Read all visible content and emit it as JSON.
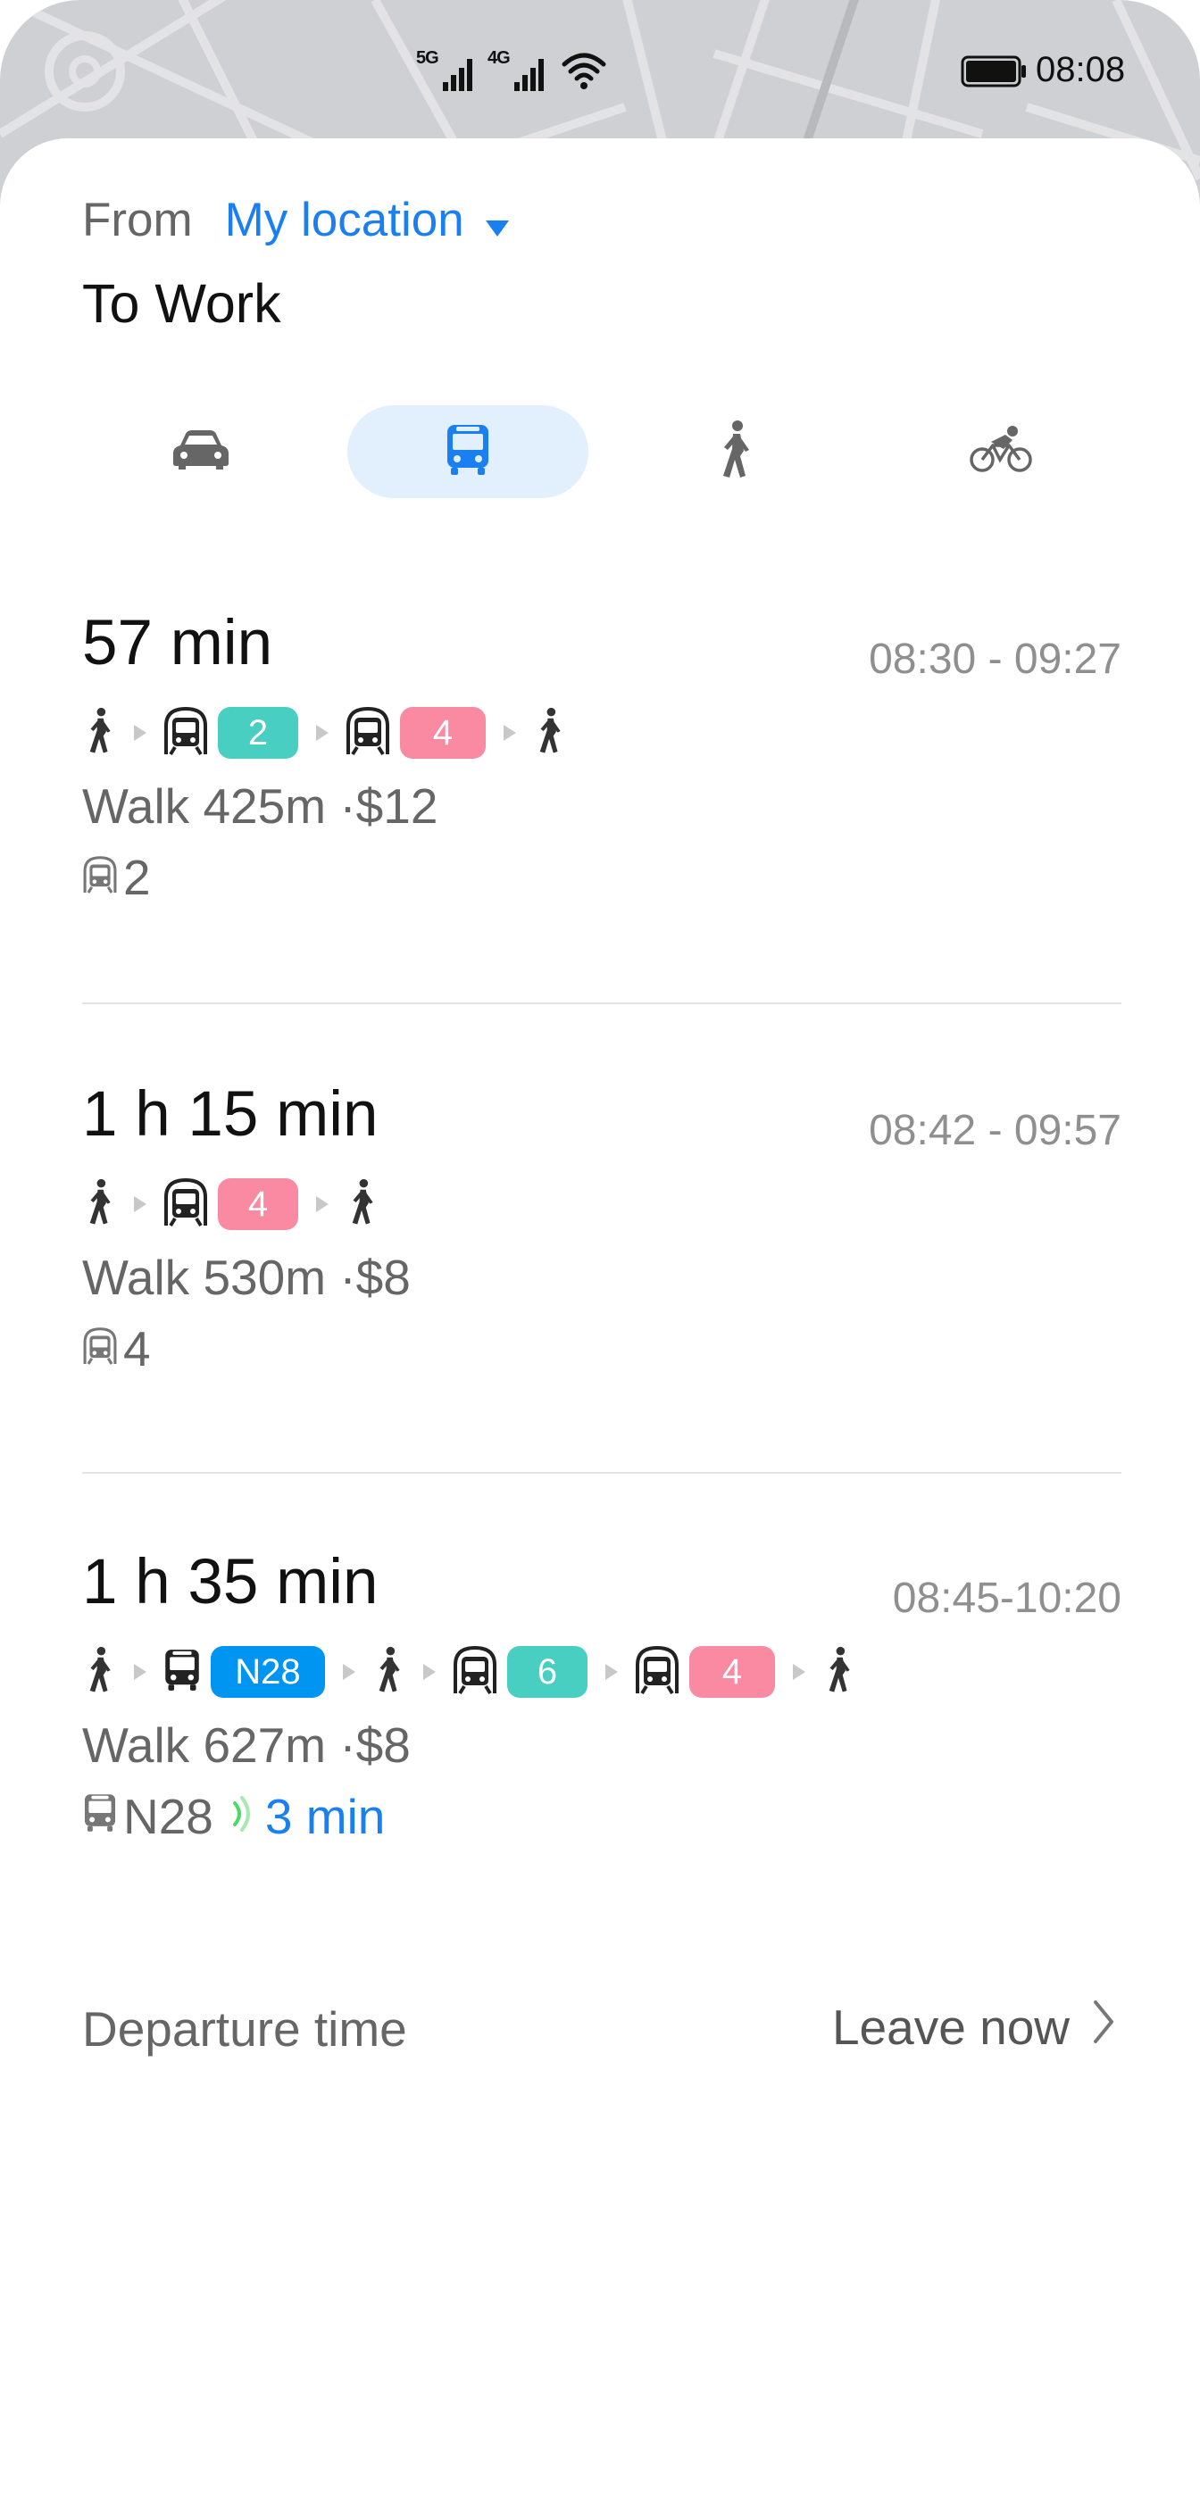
{
  "status_bar": {
    "network_1": "5G",
    "network_2": "4G",
    "time": "08:08"
  },
  "header": {
    "from_label": "From",
    "from_value": "My location",
    "to_label": "To Work"
  },
  "modes": [
    {
      "name": "car-icon",
      "active": false
    },
    {
      "name": "bus-icon",
      "active": true
    },
    {
      "name": "walk-icon",
      "active": false
    },
    {
      "name": "bike-icon",
      "active": false
    }
  ],
  "routes": [
    {
      "duration": "57 min",
      "times": "08:30 - 09:27",
      "desc": "Walk 425m ·$12",
      "sub_line": "2",
      "badges": [
        "2",
        "4"
      ]
    },
    {
      "duration": "1 h 15 min",
      "times": "08:42 - 09:57",
      "desc": "Walk 530m ·$8",
      "sub_line": "4",
      "badges": [
        "4"
      ]
    },
    {
      "duration": "1 h 35 min",
      "times": "08:45-10:20",
      "desc": "Walk 627m ·$8",
      "sub_line": "N28",
      "sub_eta": "3 min",
      "badges": [
        "N28",
        "6",
        "4"
      ]
    }
  ],
  "footer": {
    "departure_label": "Departure time",
    "leave_now": "Leave now"
  },
  "colors": {
    "accent": "#1a7ff0",
    "line_teal": "#48cfc1",
    "line_pink": "#fa8aa2",
    "line_blue": "#0095f0",
    "active_tab_bg": "#e2f0fd"
  }
}
